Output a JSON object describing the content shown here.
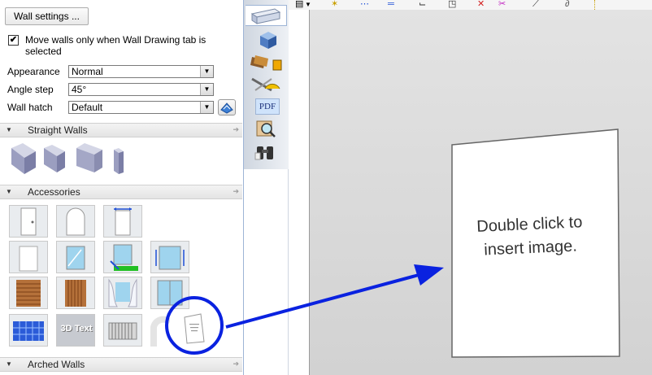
{
  "panel": {
    "wall_settings_button": "Wall settings ...",
    "move_walls_checkbox": {
      "checked": true,
      "label": "Move walls only when Wall Drawing tab is selected"
    },
    "fields": [
      {
        "label": "Appearance",
        "value": "Normal"
      },
      {
        "label": "Angle step",
        "value": "45°"
      },
      {
        "label": "Wall hatch",
        "value": "Default"
      }
    ],
    "sections": {
      "straight_walls": "Straight Walls",
      "accessories": "Accessories",
      "arched_walls": "Arched Walls"
    },
    "accessory_tiles": {
      "text_3d_label": "3D Text"
    }
  },
  "vertical_tabs": {
    "pdf_label": "PDF"
  },
  "canvas": {
    "placeholder_text": "Double click to insert image."
  },
  "colors": {
    "annotation_blue": "#0a22e0",
    "panel_border": "#9db4d6"
  },
  "icons": [
    "wall-tab-icon",
    "3d-view-icon",
    "materials-icon",
    "tools-icon",
    "pdf-icon",
    "search-icon",
    "binoculars-icon"
  ]
}
